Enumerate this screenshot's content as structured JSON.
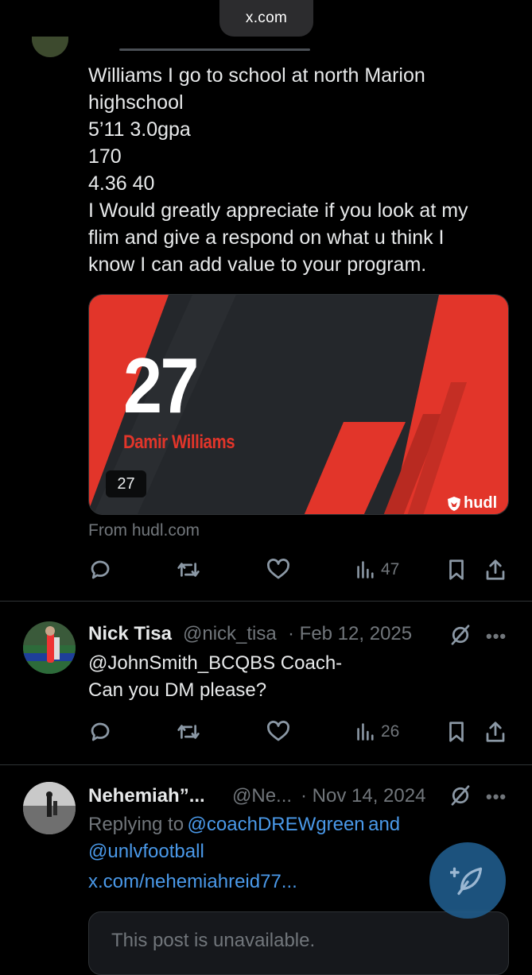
{
  "browser": {
    "url": "x.com"
  },
  "post1": {
    "text": "Williams I go to school at north Marion\nhighschool\n5’11  3.0gpa\n170\n4.36 40\nI Would greatly appreciate if you look at my\nflim and give a respond on what u think I\nknow I can add value to your program.",
    "card": {
      "number": "27",
      "player_name": "Damir Williams",
      "badge": "27",
      "brand": "hudl",
      "source": "From hudl.com"
    },
    "views": "47"
  },
  "post2": {
    "name": "Nick Tisa",
    "handle": "@nick_tisa",
    "date": "· Feb 12, 2025",
    "text": "@JohnSmith_BCQBS Coach-\nCan you DM please?",
    "views": "26"
  },
  "post3": {
    "name": "Nehemiah”...",
    "handle": "@Ne...",
    "date": "· Nov 14, 2024",
    "reply_prefix": "Replying to",
    "reply_user1": "@coachDREWgreen",
    "reply_and": "and",
    "reply_user2": "@unlvfootball",
    "link": "x.com/nehemiahreid77...",
    "unavailable": "This post is unavailable."
  },
  "more": "•••",
  "colors": {
    "accent": "#1d9bf0",
    "brand_red": "#e2352a",
    "background": "#000000"
  }
}
